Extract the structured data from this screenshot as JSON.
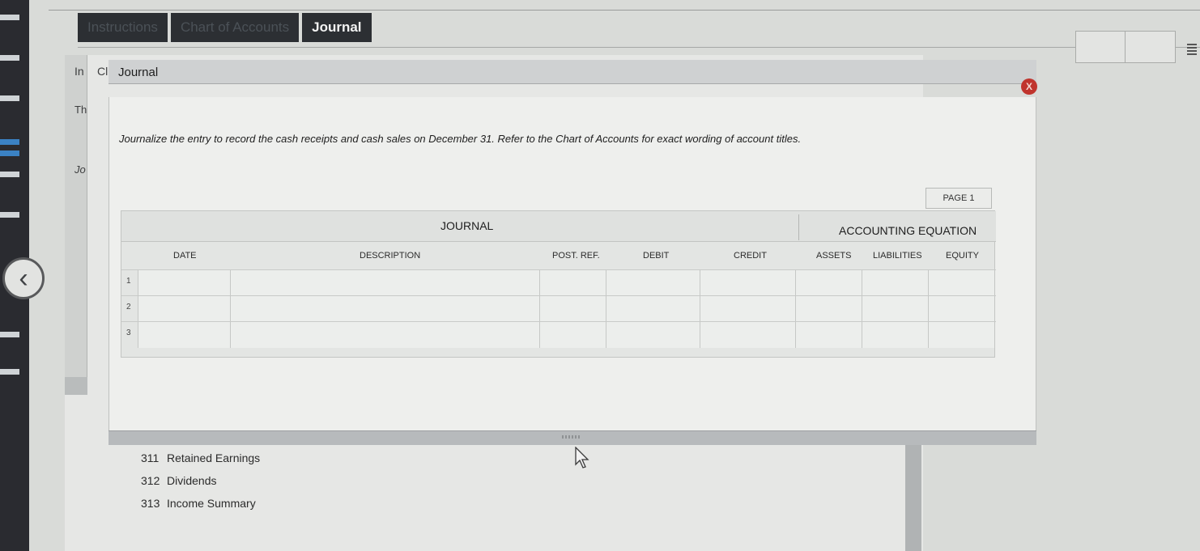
{
  "tabs": [
    {
      "label": "Instructions",
      "active": false
    },
    {
      "label": "Chart of Accounts",
      "active": false
    },
    {
      "label": "Journal",
      "active": true
    }
  ],
  "background_panel": {
    "header_fragments": [
      "In",
      "Cl"
    ],
    "side_fragments": [
      "Th",
      "Jo"
    ]
  },
  "dialog": {
    "title": "Journal",
    "close_label": "X",
    "instruction": "Journalize the entry to record the cash receipts and cash sales on December 31. Refer to the Chart of Accounts for exact wording of account titles.",
    "page_label": "PAGE 1"
  },
  "journal_table": {
    "journal_header": "JOURNAL",
    "equation_header": "ACCOUNTING EQUATION",
    "columns": {
      "date": "DATE",
      "description": "DESCRIPTION",
      "post_ref": "POST. REF.",
      "debit": "DEBIT",
      "credit": "CREDIT",
      "assets": "ASSETS",
      "liabilities": "LIABILITIES",
      "equity": "EQUITY"
    },
    "rows": [
      {
        "number": "1"
      },
      {
        "number": "2"
      },
      {
        "number": "3"
      }
    ]
  },
  "accounts": [
    {
      "number": "311",
      "name": "Retained Earnings"
    },
    {
      "number": "312",
      "name": "Dividends"
    },
    {
      "number": "313",
      "name": "Income Summary"
    }
  ],
  "colors": {
    "tab_bg": "#2c2f33",
    "close_red": "#c0342d",
    "page_bg": "#d9dbd8"
  }
}
